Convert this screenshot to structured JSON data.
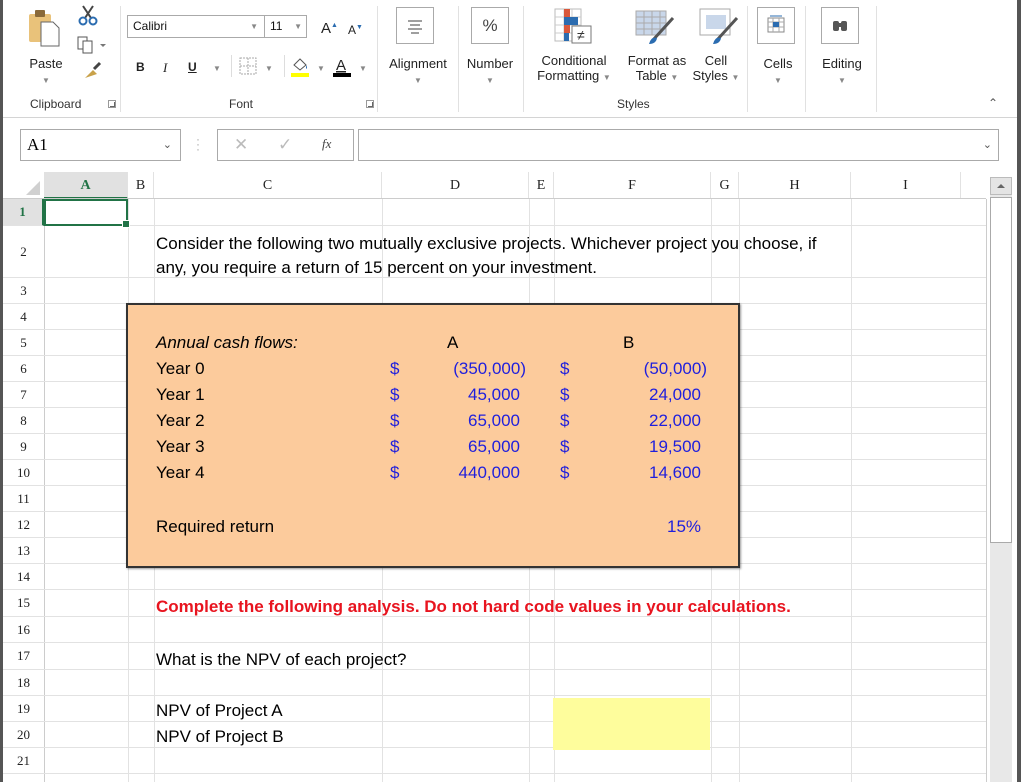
{
  "ribbon": {
    "clipboard": {
      "paste_label": "Paste",
      "group_label": "Clipboard",
      "icons": [
        "paste-icon",
        "cut-icon",
        "copy-icon",
        "format-painter-icon"
      ]
    },
    "font": {
      "font_name": "Calibri",
      "font_size": "11",
      "bold": "B",
      "italic": "I",
      "underline": "U",
      "group_label": "Font",
      "fill_color": "#ffff00",
      "font_color": "#000000"
    },
    "alignment_label": "Alignment",
    "number_label": "Number",
    "number_icon_text": "%",
    "styles": {
      "conditional_formatting": [
        "Conditional",
        "Formatting"
      ],
      "format_as_table": [
        "Format as",
        "Table"
      ],
      "cell_styles": [
        "Cell",
        "Styles"
      ],
      "group_label": "Styles"
    },
    "cells_label": "Cells",
    "editing_label": "Editing"
  },
  "formula_bar": {
    "name_box": "A1",
    "formula": "",
    "fx_label": "fx"
  },
  "columns": [
    "A",
    "B",
    "C",
    "D",
    "E",
    "F",
    "G",
    "H",
    "I"
  ],
  "selected_column": "A",
  "rows": [
    "1",
    "2",
    "3",
    "4",
    "5",
    "6",
    "7",
    "8",
    "9",
    "10",
    "11",
    "12",
    "13",
    "14",
    "15",
    "16",
    "17",
    "18",
    "19",
    "20",
    "21"
  ],
  "selected_row": "1",
  "sheet": {
    "intro_line1": "Consider the following two mutually exclusive projects.  Whichever project you choose, if",
    "intro_line2": "any, you require a return of 15 percent on your investment.",
    "cash_flows": {
      "heading": "Annual cash flows:",
      "col_a": "A",
      "col_b": "B",
      "currency": "$",
      "years": [
        {
          "label": "Year 0",
          "a": "(350,000)",
          "b": "(50,000)"
        },
        {
          "label": "Year 1",
          "a": "45,000",
          "b": "24,000"
        },
        {
          "label": "Year 2",
          "a": "65,000",
          "b": "22,000"
        },
        {
          "label": "Year 3",
          "a": "65,000",
          "b": "19,500"
        },
        {
          "label": "Year 4",
          "a": "440,000",
          "b": "14,600"
        }
      ],
      "required_return_label": "Required return",
      "required_return_value": "15%"
    },
    "instruction": "Complete the following analysis. Do not hard code values in your calculations.",
    "question": "What is the NPV of each project?",
    "npv_a_label": "NPV of Project A",
    "npv_b_label": "NPV of Project B",
    "npv_a_value": "",
    "npv_b_value": "",
    "colors": {
      "input_box": "#fccb9c",
      "answer_cell": "#fefd9c",
      "input_values": "#1f1fdd",
      "instruction": "#e8141f",
      "selection": "#217346"
    }
  }
}
